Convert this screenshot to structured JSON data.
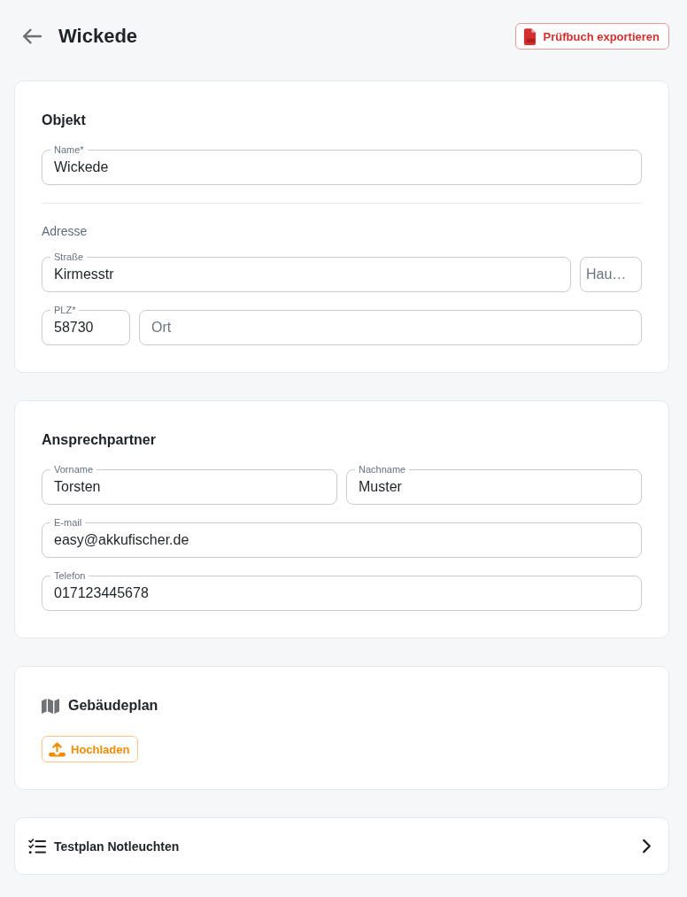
{
  "header": {
    "title": "Wickede",
    "export_button": "Prüfbuch exportieren"
  },
  "objekt": {
    "title": "Objekt",
    "name": {
      "label": "Name*",
      "value": "Wickede"
    },
    "address_heading": "Adresse",
    "street": {
      "label": "Straße",
      "value": "Kirmesstr"
    },
    "house_number": {
      "placeholder": "Hau…"
    },
    "postal_code": {
      "label": "PLZ*",
      "value": "58730"
    },
    "city": {
      "placeholder": "Ort"
    }
  },
  "contact": {
    "title": "Ansprechpartner",
    "first_name": {
      "label": "Vorname",
      "value": "Torsten"
    },
    "last_name": {
      "label": "Nachname",
      "value": "Muster"
    },
    "email": {
      "label": "E-mail",
      "value": "easy@akkufischer.de"
    },
    "phone": {
      "label": "Telefon",
      "value": "017123445678"
    }
  },
  "building_plan": {
    "title": "Gebäudeplan",
    "upload_button": "Hochladen"
  },
  "test_plan": {
    "label": "Testplan Notleuchten"
  }
}
